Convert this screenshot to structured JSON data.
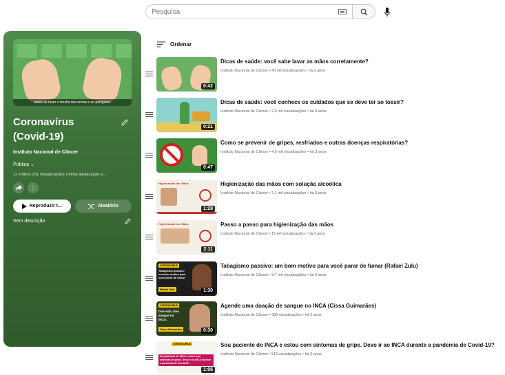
{
  "search": {
    "placeholder": "Pesquisa"
  },
  "playlist": {
    "title": "Coronavírus (Covid-19)",
    "channel": "Instituto Nacional de Câncer",
    "privacy": "Pública",
    "stats": "11 vídeos  251 visualizações  Última atualização e...",
    "play_label": "Reproduzir t...",
    "shuffle_label": "Aleatório",
    "description": "Sem descrição",
    "hero_caption": "antes de fazer o lanche das urinas e ao polegares"
  },
  "sort_label": "Ordenar",
  "videos": [
    {
      "title": "Dicas de saúde: você sabe lavar as mãos corretamente?",
      "meta": "Instituto Nacional de Câncer • 43 mil visualizações • há 2 anos",
      "duration": "0:42"
    },
    {
      "title": "Dicas de saúde: você conhece os cuidados que se deve ter ao tossir?",
      "meta": "Instituto Nacional de Câncer • 2,6 mil visualizações • há 3 anos",
      "duration": "0:21"
    },
    {
      "title": "Como se prevenir de gripes, resfriados e outras doenças respiratórias?",
      "meta": "Instituto Nacional de Câncer • 4,9 mil visualizações • há 3 anos",
      "duration": "0:47"
    },
    {
      "title": "Higienização das mãos com solução alcoólica",
      "meta": "Instituto Nacional de Câncer • 2,1 mil visualizações • há 3 anos",
      "duration": "1:28"
    },
    {
      "title": "Passo a passo para higienização das mãos",
      "meta": "Instituto Nacional de Câncer • 15 mil visualizações • há 3 anos",
      "duration": "2:11"
    },
    {
      "title": "Tabagismo passivo: um bom motivo para você parar de fumar (Rafael Zulu)",
      "meta": "Instituto Nacional de Câncer • 3,7 mil visualizações • há 3 anos",
      "duration": "1:30"
    },
    {
      "title": "Agende uma doação de sangue no INCA (Cissa Guimarães)",
      "meta": "Instituto Nacional de Câncer • 996 visualizações • há 2 anos",
      "duration": "0:30"
    },
    {
      "title": "Sou paciente do INCA e estou com sintomas de gripe. Devo ir ao INCA durante a pandemia de Covid-19?",
      "meta": "Instituto Nacional de Câncer • 515 visualizações • há 2 anos",
      "duration": "1:06"
    }
  ],
  "thumb_text": {
    "t4": "Higienização das Mãos",
    "t5": "Higienização das Mãos",
    "t6": "Tabagismo passivo: um bom motivo para você parar de fumar",
    "t6_name": "Rafael Zulu",
    "t6_tag": "CORONAVÍRUS",
    "t7": "Doe vida. Doe sangue no INCA.",
    "t7_name": "Cissa Guimarães",
    "t7_tag": "CORONAVÍRUS",
    "t8": "Sou paciente do INCA e estou com sintomas de gripe. Devo ir ao INCA durante a pandemia de Covid-19?",
    "t8_tag": "CORONAVÍRUS"
  }
}
